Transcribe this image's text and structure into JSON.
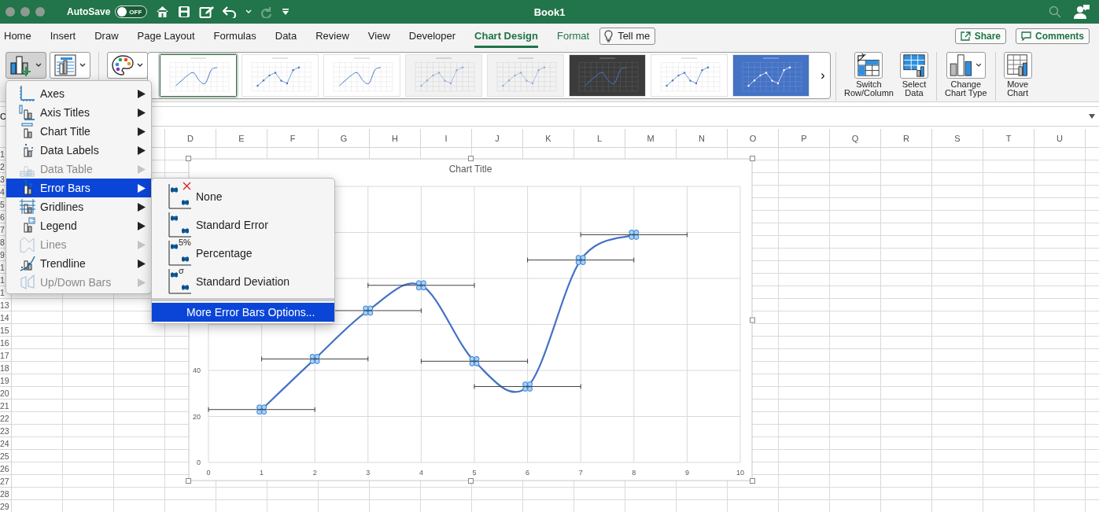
{
  "titlebar": {
    "autosave": {
      "label": "AutoSave",
      "state": "OFF",
      "on": false
    },
    "title": "Book1"
  },
  "tabs": [
    {
      "label": "Home",
      "selected": false,
      "contextual": false
    },
    {
      "label": "Insert",
      "selected": false,
      "contextual": false
    },
    {
      "label": "Draw",
      "selected": false,
      "contextual": false
    },
    {
      "label": "Page Layout",
      "selected": false,
      "contextual": false
    },
    {
      "label": "Formulas",
      "selected": false,
      "contextual": false
    },
    {
      "label": "Data",
      "selected": false,
      "contextual": false
    },
    {
      "label": "Review",
      "selected": false,
      "contextual": false
    },
    {
      "label": "View",
      "selected": false,
      "contextual": false
    },
    {
      "label": "Developer",
      "selected": false,
      "contextual": false
    },
    {
      "label": "Chart Design",
      "selected": true,
      "contextual": true
    },
    {
      "label": "Format",
      "selected": false,
      "contextual": true
    }
  ],
  "tell_me": "Tell me",
  "share": "Share",
  "comments": "Comments",
  "ribbon": {
    "left_buttons": [
      {
        "kind": "add-element",
        "pressed": true
      },
      {
        "kind": "quick-layout",
        "pressed": false
      },
      {
        "kind": "colors",
        "pressed": false
      }
    ],
    "chart_styles": [
      {
        "kind": "light",
        "markers": false,
        "selected": true
      },
      {
        "kind": "light",
        "markers": true,
        "selected": false
      },
      {
        "kind": "light",
        "markers": false,
        "selected": false
      },
      {
        "kind": "shaded",
        "markers": true,
        "selected": false
      },
      {
        "kind": "shaded",
        "markers": true,
        "selected": false
      },
      {
        "kind": "dark",
        "markers": false,
        "selected": false
      },
      {
        "kind": "light",
        "markers": true,
        "selected": false
      },
      {
        "kind": "blue",
        "markers": true,
        "selected": false
      }
    ],
    "gallery_next": "›",
    "commands": [
      {
        "label": "Switch\nRow/Column",
        "kind": "switch"
      },
      {
        "label": "Select\nData",
        "kind": "select-data"
      },
      {
        "label": "Change\nChart Type",
        "kind": "change-type"
      },
      {
        "label": "Move\nChart",
        "kind": "move"
      }
    ]
  },
  "formula_bar": {
    "name_box": "C"
  },
  "sheet": {
    "columns": [
      "D",
      "E",
      "F",
      "G",
      "H",
      "I",
      "J",
      "K",
      "L",
      "M",
      "N",
      "O",
      "P",
      "Q",
      "R",
      "S",
      "T",
      "U"
    ],
    "rows": [
      "1",
      "2",
      "3",
      "4",
      "5",
      "6",
      "7",
      "8",
      "9",
      "1",
      "1",
      "1",
      "13",
      "14",
      "15",
      "16",
      "17",
      "18",
      "19",
      "20",
      "21",
      "22",
      "23",
      "24",
      "25",
      "26",
      "27",
      "28",
      "29"
    ],
    "chart": {
      "chart_data": {
        "type": "line",
        "title": "Chart Title",
        "x": [
          1,
          2,
          3,
          4,
          5,
          6,
          7,
          8
        ],
        "series": [
          {
            "color": "#4472c4",
            "values": [
              23,
              45,
              66,
              77,
              44,
              33,
              88,
              99
            ]
          }
        ],
        "grid": true,
        "xlim": [
          0,
          10
        ],
        "ylim": [
          0,
          120
        ],
        "xticks": [
          0,
          1,
          2,
          3,
          4,
          5,
          6,
          7,
          8,
          9,
          10
        ],
        "yticks": [
          0,
          20,
          40
        ]
      },
      "error_bars": {
        "horizontal": true,
        "amount": "1"
      }
    }
  },
  "chart_elements_menu": {
    "items": [
      {
        "label": "Axes",
        "kind": "axes",
        "disabled": false,
        "selected": false
      },
      {
        "label": "Axis Titles",
        "kind": "axis-titles",
        "disabled": false,
        "selected": false
      },
      {
        "label": "Chart Title",
        "kind": "chart-title",
        "disabled": false,
        "selected": false
      },
      {
        "label": "Data Labels",
        "kind": "data-labels",
        "disabled": false,
        "selected": false
      },
      {
        "label": "Data Table",
        "kind": "data-table",
        "disabled": true,
        "selected": false
      },
      {
        "label": "Error Bars",
        "kind": "error-bars",
        "disabled": false,
        "selected": true
      },
      {
        "label": "Gridlines",
        "kind": "gridlines",
        "disabled": false,
        "selected": false
      },
      {
        "label": "Legend",
        "kind": "legend",
        "disabled": false,
        "selected": false
      },
      {
        "label": "Lines",
        "kind": "lines",
        "disabled": true,
        "selected": false
      },
      {
        "label": "Trendline",
        "kind": "trendline",
        "disabled": false,
        "selected": false
      },
      {
        "label": "Up/Down Bars",
        "kind": "up-down-bars",
        "disabled": true,
        "selected": false
      }
    ]
  },
  "error_bars_submenu": {
    "items": [
      {
        "label": "None",
        "kind": "none",
        "selected": false
      },
      {
        "label": "Standard Error",
        "kind": "standard-error",
        "selected": false
      },
      {
        "label": "Percentage",
        "kind": "percentage",
        "badge": "5%",
        "selected": false
      },
      {
        "label": "Standard Deviation",
        "kind": "standard-deviation",
        "badge": "σ",
        "selected": false
      },
      {
        "label": "More Error Bars Options...",
        "kind": "more",
        "selected": true
      }
    ]
  }
}
